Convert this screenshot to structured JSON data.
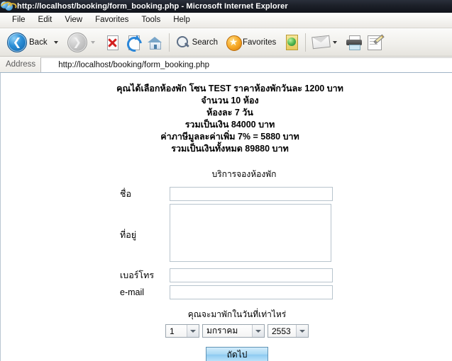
{
  "window": {
    "title": "http://localhost/booking/form_booking.php - Microsoft Internet Explorer",
    "icon": "ie-globe-icon"
  },
  "menu": {
    "items": [
      {
        "label": "File"
      },
      {
        "label": "Edit"
      },
      {
        "label": "View"
      },
      {
        "label": "Favorites"
      },
      {
        "label": "Tools"
      },
      {
        "label": "Help"
      }
    ]
  },
  "toolbar": {
    "back_label": "Back",
    "search_label": "Search",
    "favorites_label": "Favorites"
  },
  "address": {
    "label": "Address",
    "url": "http://localhost/booking/form_booking.php"
  },
  "page": {
    "summary": [
      "คุณได้เลือกห้องพัก โซน TEST ราคาห้องพักวันละ 1200 บาท",
      "จำนวน 10 ห้อง",
      "ห้องละ 7 วัน",
      "รวมเป็นเงิน 84000 บาท",
      "ค่าภาษีมูลละค่าเพิ่ม 7% = 5880 บาท",
      "รวมเป็นเงินทั้งหมด 89880 บาท"
    ],
    "form_title": "บริการจองห้องพัก",
    "fields": {
      "name_label": "ชื่อ",
      "name_value": "",
      "address_label": "ที่อยู่",
      "address_value": "",
      "phone_label": "เบอร์โทร",
      "phone_value": "",
      "email_label": "e-mail",
      "email_value": ""
    },
    "date": {
      "title": "คุณจะมาพักในวันที่เท่าไหร่",
      "day": "1",
      "month": "มกราคม",
      "year": "2553"
    },
    "submit_label": "ถัดไป"
  },
  "colors": {
    "titlebar": "#1c2029",
    "accent_blue": "#2b8ed6",
    "favorite_orange": "#f5a623",
    "stop_red": "#d32020",
    "button_blue": "#a9d9f4"
  }
}
